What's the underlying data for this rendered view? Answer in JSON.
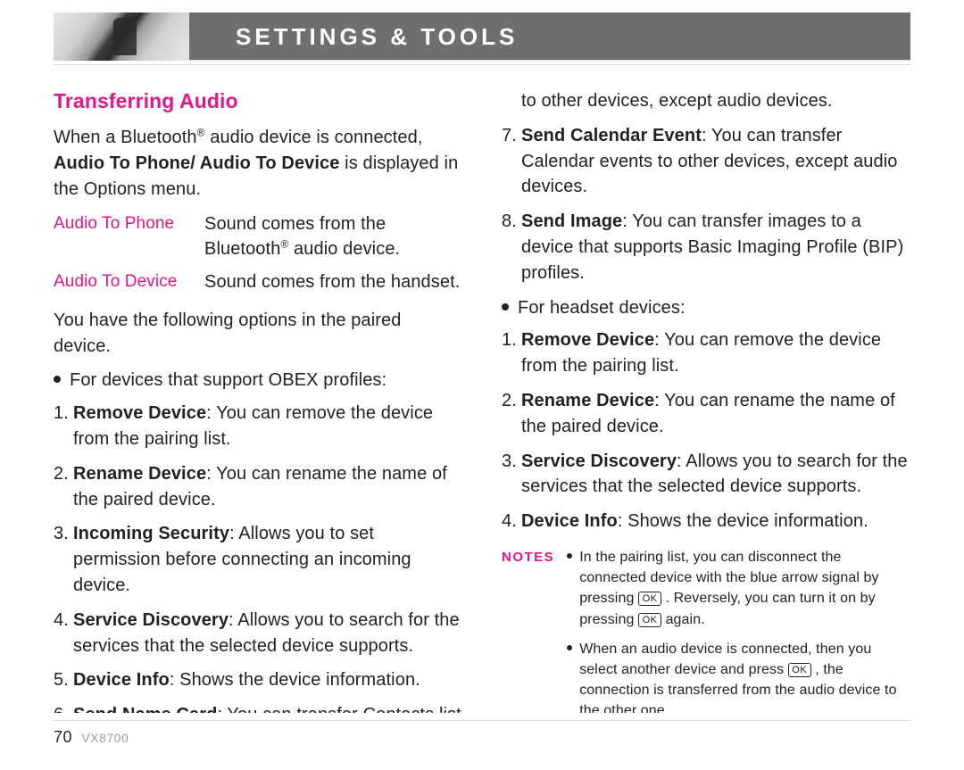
{
  "header": {
    "title": "SETTINGS & TOOLS"
  },
  "section_heading": "Transferring Audio",
  "intro": {
    "line1_pre": "When a Bluetooth",
    "line1_post": " audio device is connected, ",
    "bold": "Audio To Phone/ Audio To Device",
    "line2": " is displayed in the Options menu."
  },
  "defs": {
    "term1": "Audio To Phone",
    "desc1_pre": "Sound comes from the Bluetooth",
    "desc1_post": " audio device.",
    "term2": "Audio To Device",
    "desc2": "Sound comes from the handset."
  },
  "options_intro": "You have the following options in the paired device.",
  "bullet_obex": "For devices that support OBEX profiles:",
  "obex": {
    "i1_b": "Remove Device",
    "i1_t": ": You can remove the device from the pairing list.",
    "i2_b": "Rename Device",
    "i2_t": ": You can rename the name of the paired device.",
    "i3_b": "Incoming Security",
    "i3_t": ": Allows you to set permission before connecting an incoming device.",
    "i4_b": "Service Discovery",
    "i4_t": ": Allows you to search for the services that the selected device supports.",
    "i5_b": "Device Info",
    "i5_t": ": Shows the device information.",
    "i6_b": "Send Name Card",
    "i6_t": ": You can transfer Contacts list",
    "i6_cont": "to other devices, except audio devices.",
    "i7_b": "Send Calendar Event",
    "i7_t": ": You can transfer Calendar events to other devices, except audio devices.",
    "i8_b": "Send Image",
    "i8_t": ": You can transfer images to a device that supports Basic Imaging Profile (BIP) profiles."
  },
  "bullet_headset": "For headset devices:",
  "headset": {
    "i1_b": "Remove Device",
    "i1_t": ": You can remove the device from the pairing list.",
    "i2_b": "Rename Device",
    "i2_t": ": You can rename the name of the paired device.",
    "i3_b": "Service Discovery",
    "i3_t": ": Allows you to search for the services that the selected device supports.",
    "i4_b": "Device Info",
    "i4_t": ": Shows the device information."
  },
  "notes": {
    "label": "NOTES",
    "n1_a": "In the pairing list, you can disconnect the connected device with the blue arrow signal by pressing ",
    "n1_b": " . Reversely, you can turn it on by pressing ",
    "n1_c": " again.",
    "n2_a": "When an audio device is connected, then you select another device and press ",
    "n2_b": " , the connection is transferred from the audio device to the other one.",
    "ok": "OK"
  },
  "footer": {
    "page": "70",
    "model": "VX8700"
  }
}
